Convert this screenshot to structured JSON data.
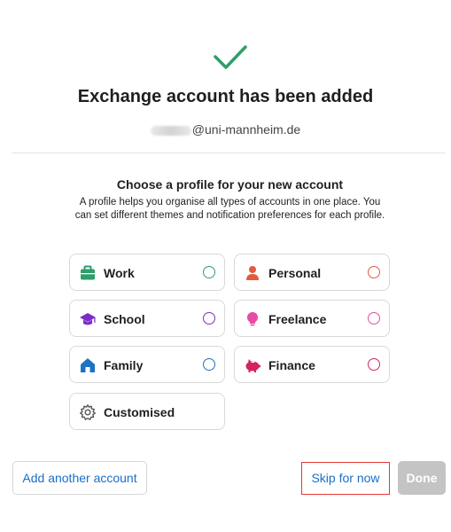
{
  "header": {
    "title": "Exchange account has been added",
    "email_suffix": "@uni-mannheim.de"
  },
  "profile_section": {
    "heading": "Choose a profile for your new account",
    "description": "A profile helps you organise all types of accounts in one place. You can set different themes and notification preferences for each profile."
  },
  "profiles": [
    {
      "label": "Work",
      "icon": "briefcase-icon",
      "color": "#2e9e6b"
    },
    {
      "label": "Personal",
      "icon": "person-icon",
      "color": "#e35a3c"
    },
    {
      "label": "School",
      "icon": "graduation-cap-icon",
      "color": "#7a2ec9"
    },
    {
      "label": "Freelance",
      "icon": "lightbulb-icon",
      "color": "#e64ba6"
    },
    {
      "label": "Family",
      "icon": "house-icon",
      "color": "#1f73c2"
    },
    {
      "label": "Finance",
      "icon": "piggy-bank-icon",
      "color": "#d4245b"
    },
    {
      "label": "Customised",
      "icon": "gear-icon",
      "color": "#555555"
    }
  ],
  "footer": {
    "add_account_label": "Add another account",
    "skip_label": "Skip for now",
    "done_label": "Done"
  },
  "colors": {
    "success_check": "#2e9e6b",
    "link_blue": "#1a6fc9",
    "highlight_border": "#e53935",
    "done_disabled": "#c4c4c4"
  }
}
